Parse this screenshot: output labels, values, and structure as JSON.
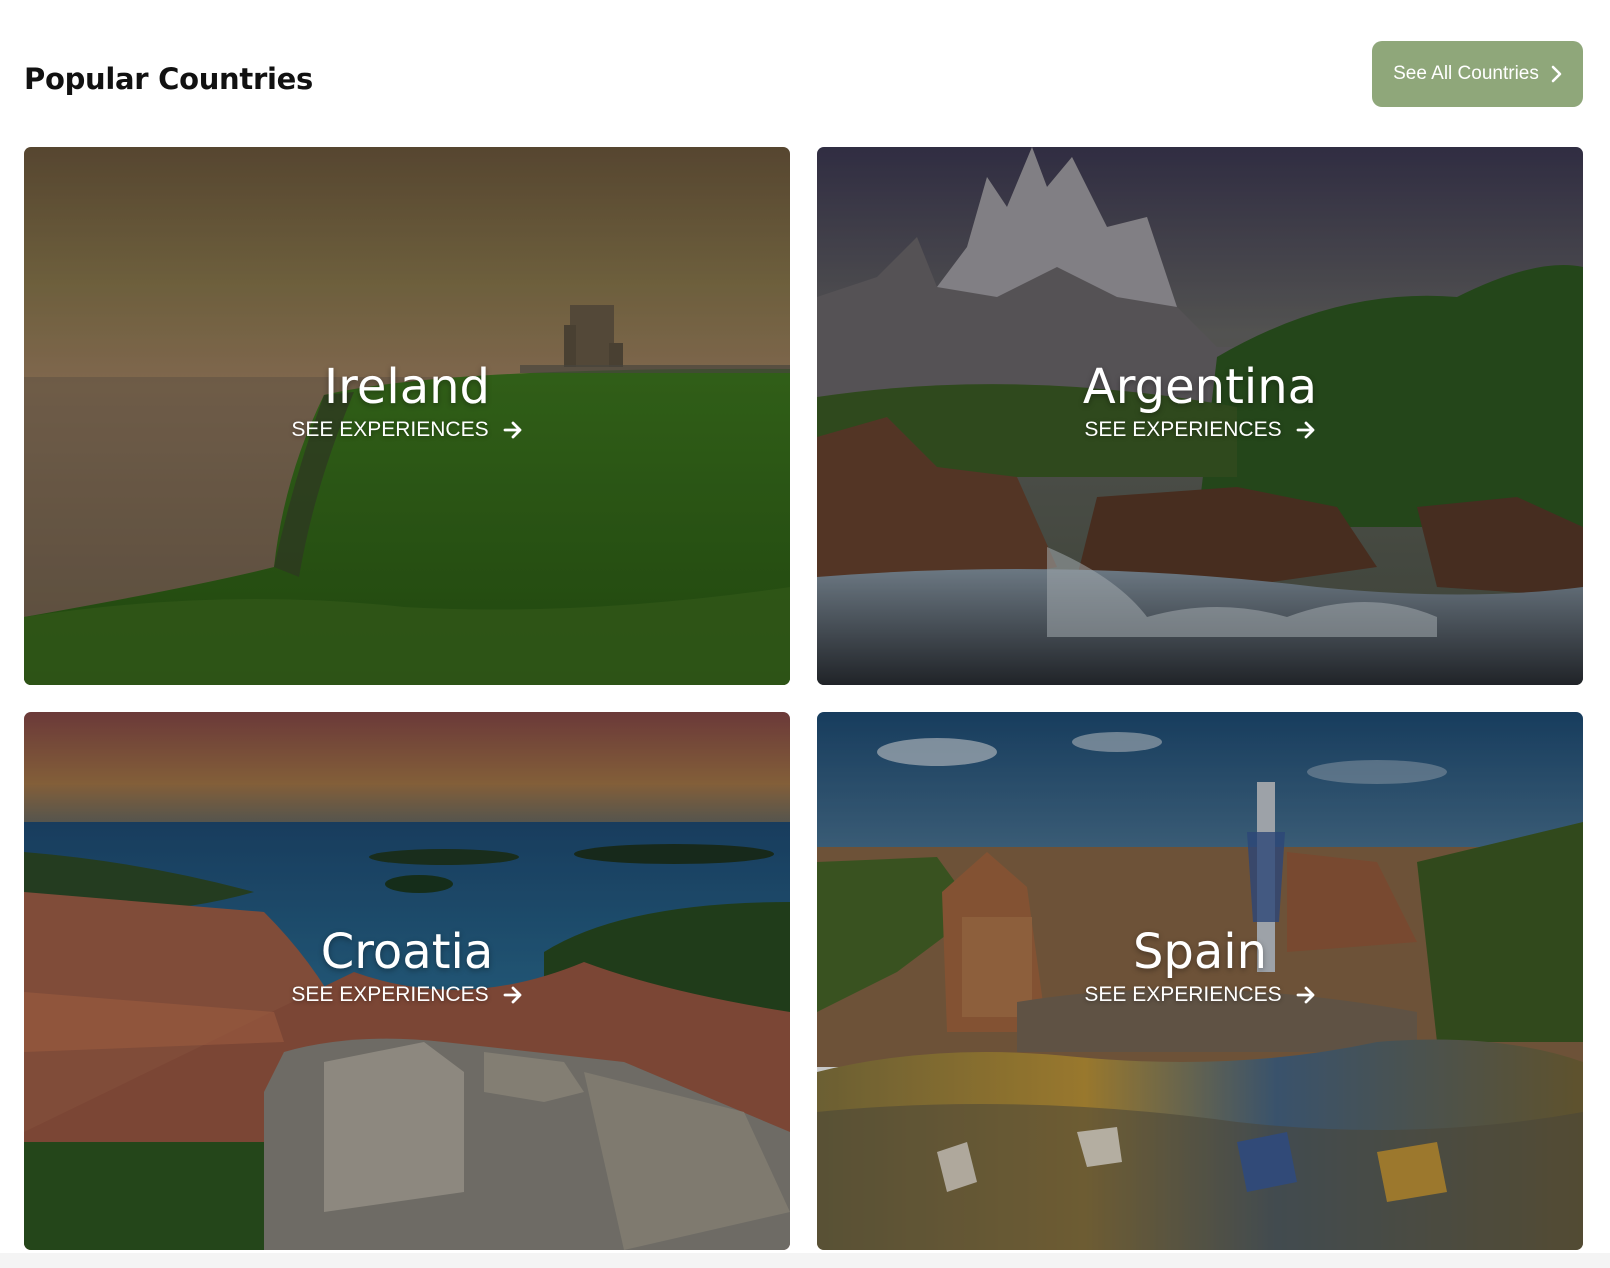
{
  "section": {
    "title": "Popular Countries",
    "see_all_label": "See All Countries"
  },
  "cards": [
    {
      "name": "Ireland",
      "cta": "SEE EXPERIENCES"
    },
    {
      "name": "Argentina",
      "cta": "SEE EXPERIENCES"
    },
    {
      "name": "Croatia",
      "cta": "SEE EXPERIENCES"
    },
    {
      "name": "Spain",
      "cta": "SEE EXPERIENCES"
    }
  ],
  "colors": {
    "accent_button": "#8fa77a",
    "title_text": "#111111",
    "card_text": "#ffffff"
  },
  "icons": {
    "see_all": "chevron-right-icon",
    "card_link": "arrow-right-icon"
  }
}
